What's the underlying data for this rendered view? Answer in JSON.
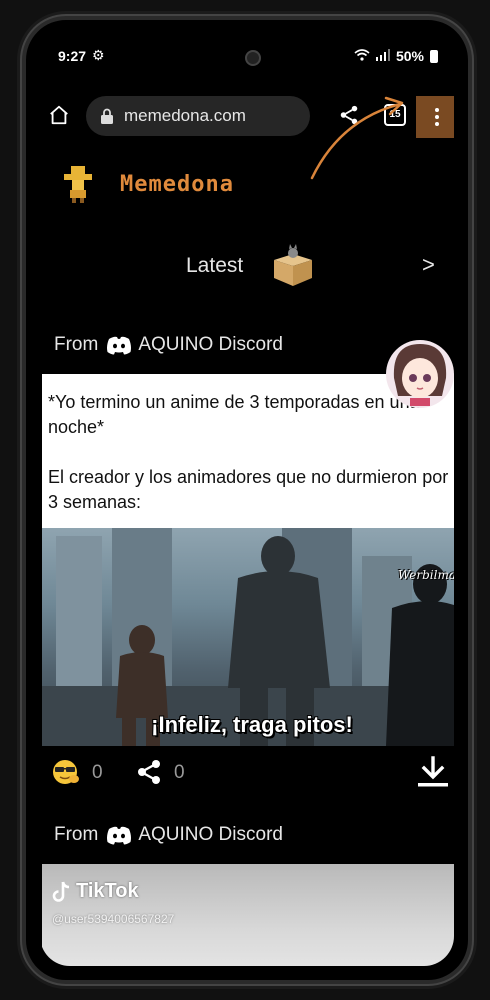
{
  "status_bar": {
    "time": "9:27",
    "battery": "50%"
  },
  "browser": {
    "url": "memedona.com",
    "tab_count": "15"
  },
  "site": {
    "name": "Memedona"
  },
  "latest": {
    "label": "Latest",
    "next": ">"
  },
  "posts": [
    {
      "from_prefix": "From",
      "source": "AQUINO Discord",
      "caption_lines": [
        "*Yo termino un anime de 3 temporadas en una noche*",
        "El creador y los animadores que no durmieron por 3 semanas:"
      ],
      "meme_caption": "¡Infeliz, traga pitos!",
      "watermark": "Werbilma",
      "reactions": "0",
      "shares": "0"
    },
    {
      "from_prefix": "From",
      "source": "AQUINO Discord",
      "tiktok_label": "TikTok",
      "tiktok_user": "@user5394006567827"
    }
  ],
  "colors": {
    "accent": "#e08a3c",
    "menu_highlight": "#7a4a22"
  }
}
